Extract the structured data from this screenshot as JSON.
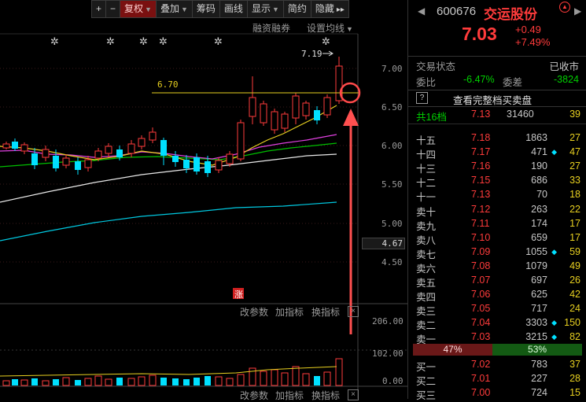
{
  "toolbar": {
    "plus": "+",
    "minus": "−",
    "fuquan": "复权",
    "diejia": "叠加",
    "chouma": "筹码",
    "huaxian": "画线",
    "xianshi": "显示",
    "jianyue": "简约",
    "yincang": "隐藏",
    "more": "▸▸"
  },
  "chart_links": {
    "rongzi": "融资融券",
    "shezhi": "设置均线"
  },
  "price_axis": [
    "7.00",
    "6.50",
    "6.00",
    "5.50",
    "5.00",
    "4.67",
    "4.50"
  ],
  "current_axis_price": "4.67",
  "annotations": {
    "high": "7.19",
    "level": "6.70",
    "zhang_badge": "涨"
  },
  "sub1": {
    "gaicanshu": "改参数",
    "jiazhibiao": "加指标",
    "huanzhibiao": "换指标",
    "close": "×",
    "ticks": [
      "206.00",
      "102.00",
      "0.00"
    ]
  },
  "sub2": {
    "gaicanshu": "改参数",
    "jiazhibiao": "加指标",
    "huanzhibiao": "换指标"
  },
  "quote": {
    "code": "600676",
    "name": "交运股份",
    "price": "7.03",
    "change": "+0.49",
    "pct": "+7.49%",
    "status_label": "交易状态",
    "status_value": "已收市",
    "weibi_label": "委比",
    "weibi_value": "-6.47%",
    "weicha_label": "委差",
    "weicha_value": "-3824",
    "view_full": "查看完整档买卖盘",
    "help": "?",
    "total_label": "共16档",
    "total_price": "7.13",
    "total_vol": "31460",
    "total_cnt": "39"
  },
  "sell_levels": [
    {
      "label": "十五",
      "price": "7.18",
      "vol": "1863",
      "mark": "",
      "cnt": "27"
    },
    {
      "label": "十四",
      "price": "7.17",
      "vol": "471",
      "mark": "◆",
      "cnt": "47"
    },
    {
      "label": "十三",
      "price": "7.16",
      "vol": "190",
      "mark": "",
      "cnt": "27"
    },
    {
      "label": "十二",
      "price": "7.15",
      "vol": "686",
      "mark": "",
      "cnt": "33"
    },
    {
      "label": "十一",
      "price": "7.13",
      "vol": "70",
      "mark": "",
      "cnt": "18"
    },
    {
      "label": "卖十",
      "price": "7.12",
      "vol": "263",
      "mark": "",
      "cnt": "22"
    },
    {
      "label": "卖九",
      "price": "7.11",
      "vol": "174",
      "mark": "",
      "cnt": "17"
    },
    {
      "label": "卖八",
      "price": "7.10",
      "vol": "659",
      "mark": "",
      "cnt": "17"
    },
    {
      "label": "卖七",
      "price": "7.09",
      "vol": "1055",
      "mark": "◆",
      "cnt": "59"
    },
    {
      "label": "卖六",
      "price": "7.08",
      "vol": "1079",
      "mark": "",
      "cnt": "49"
    },
    {
      "label": "卖五",
      "price": "7.07",
      "vol": "697",
      "mark": "",
      "cnt": "26"
    },
    {
      "label": "卖四",
      "price": "7.06",
      "vol": "625",
      "mark": "",
      "cnt": "42"
    },
    {
      "label": "卖三",
      "price": "7.05",
      "vol": "717",
      "mark": "",
      "cnt": "24"
    },
    {
      "label": "卖二",
      "price": "7.04",
      "vol": "3303",
      "mark": "◆",
      "cnt": "150"
    },
    {
      "label": "卖一",
      "price": "7.03",
      "vol": "3215",
      "mark": "◆",
      "cnt": "82"
    }
  ],
  "ratio": {
    "sell": "47%",
    "buy": "53%",
    "sell_fraction": 0.47
  },
  "buy_levels": [
    {
      "label": "买一",
      "price": "7.02",
      "vol": "783",
      "mark": "",
      "cnt": "37"
    },
    {
      "label": "买二",
      "price": "7.01",
      "vol": "227",
      "mark": "",
      "cnt": "28"
    },
    {
      "label": "买三",
      "price": "7.00",
      "vol": "724",
      "mark": "",
      "cnt": "15"
    }
  ],
  "colors": {
    "red": "#ff3b3b",
    "green": "#00d000",
    "yellow": "#e8d020",
    "cyan": "#00e0ff",
    "accent_arrow": "#ff5050"
  }
}
